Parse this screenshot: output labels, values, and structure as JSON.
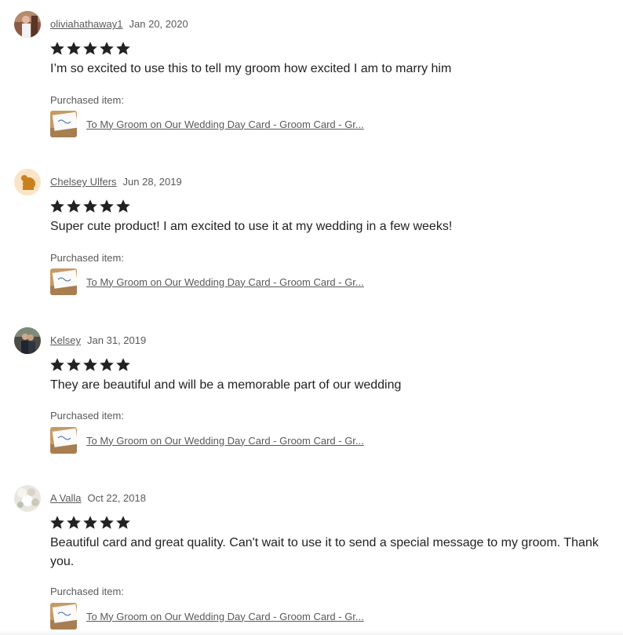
{
  "purchased_label": "Purchased item:",
  "star_count": 5,
  "rating": 5,
  "star_color": "#222222",
  "reviews": [
    {
      "reviewer": "oliviahathaway1",
      "date": "Jan 20, 2020",
      "text": "I’m so excited to use this to tell my groom how excited I am to marry him",
      "item_title": "To My Groom on Our Wedding Day Card - Groom Card - Gr..."
    },
    {
      "reviewer": "Chelsey Ulfers",
      "date": "Jun 28, 2019",
      "text": "Super cute product! I am excited to use it at my wedding in a few weeks!",
      "item_title": "To My Groom on Our Wedding Day Card - Groom Card - Gr..."
    },
    {
      "reviewer": "Kelsey",
      "date": "Jan 31, 2019",
      "text": "They are beautiful and will be a memorable part of our wedding",
      "item_title": "To My Groom on Our Wedding Day Card - Groom Card - Gr..."
    },
    {
      "reviewer": "A Valla",
      "date": "Oct 22, 2018",
      "text": "Beautiful card and great quality. Can't wait to use it to send a special message to my groom. Thank you.",
      "item_title": "To My Groom on Our Wedding Day Card - Groom Card - Gr..."
    }
  ]
}
